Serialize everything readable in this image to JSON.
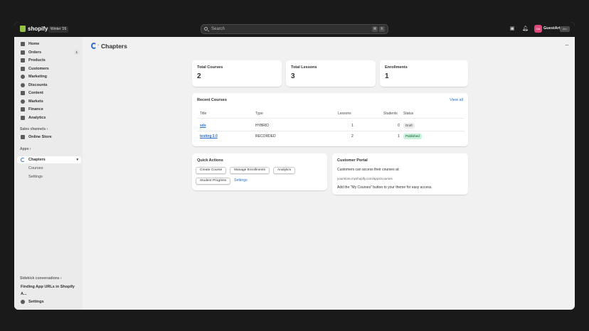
{
  "topbar": {
    "logo_text": "shopify",
    "season_badge": "Winter '26",
    "search_placeholder": "Search",
    "shortcut_keys": [
      "⌘",
      "K"
    ],
    "store_name": "GuestArt",
    "store_badge": "dev",
    "avatar_initials": "GA"
  },
  "sidebar": {
    "items": [
      {
        "label": "Home",
        "icon": "home-icon"
      },
      {
        "label": "Orders",
        "icon": "orders-icon",
        "count": "1"
      },
      {
        "label": "Products",
        "icon": "tag-icon"
      },
      {
        "label": "Customers",
        "icon": "person-icon"
      },
      {
        "label": "Marketing",
        "icon": "target-icon"
      },
      {
        "label": "Discounts",
        "icon": "discount-icon"
      },
      {
        "label": "Content",
        "icon": "content-icon"
      },
      {
        "label": "Markets",
        "icon": "globe-icon"
      },
      {
        "label": "Finance",
        "icon": "bank-icon"
      },
      {
        "label": "Analytics",
        "icon": "chart-icon"
      }
    ],
    "sales_channels_label": "Sales channels",
    "online_store_label": "Online Store",
    "apps_label": "Apps",
    "app_name": "Chapters",
    "app_subitems": [
      "Courses",
      "Settings"
    ],
    "sidekick_label": "Sidekick conversations",
    "sidekick_item": "Finding App URLs in Shopify A...",
    "settings_label": "Settings"
  },
  "page": {
    "title": "Chapters",
    "crumb_sep": "›"
  },
  "stats": [
    {
      "label": "Total Courses",
      "value": "2"
    },
    {
      "label": "Total Lessons",
      "value": "3"
    },
    {
      "label": "Enrollments",
      "value": "1"
    }
  ],
  "recent": {
    "title": "Recent Courses",
    "view_all": "View all",
    "headers": [
      "Title",
      "Type",
      "Lessons",
      "Students",
      "Status"
    ],
    "rows": [
      {
        "title": "sds",
        "type": "HYBRID",
        "lessons": "1",
        "students": "0",
        "status": "Draft"
      },
      {
        "title": "testing 2.0",
        "type": "RECORDED",
        "lessons": "2",
        "students": "1",
        "status": "Published"
      }
    ]
  },
  "quick_actions": {
    "title": "Quick Actions",
    "buttons": [
      "Create Course",
      "Manage Enrollments",
      "Analytics",
      "Student Progress"
    ],
    "settings_link": "Settings"
  },
  "portal": {
    "title": "Customer Portal",
    "line1": "Customers can access their courses at:",
    "url": "yourstore.myshopify.com/apps/courses",
    "line2": "Add the \"My Courses\" button to your theme for easy access."
  }
}
